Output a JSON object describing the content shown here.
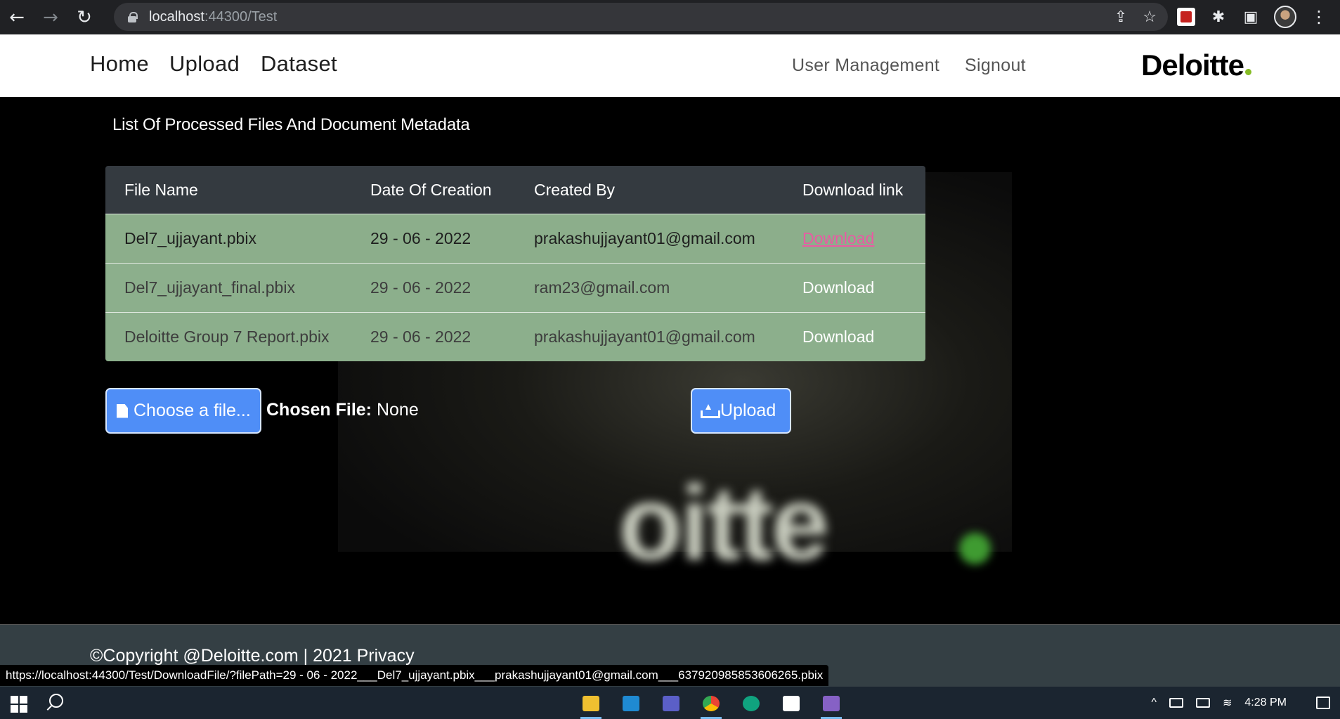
{
  "browser": {
    "url_host": "localhost",
    "url_path": ":44300/Test"
  },
  "navbar": {
    "links": [
      "Home",
      "Upload",
      "Dataset"
    ],
    "user_management": "User Management",
    "signout": "Signout",
    "logo": "Deloitte"
  },
  "main": {
    "heading": "List Of Processed Files And Document Metadata",
    "table": {
      "headers": [
        "File Name",
        "Date Of Creation",
        "Created By",
        "Download link"
      ],
      "rows": [
        {
          "file": "Del7_ujjayant.pbix",
          "date": "29 - 06 - 2022",
          "by": "prakashujjayant01@gmail.com",
          "link": "Download"
        },
        {
          "file": "Del7_ujjayant_final.pbix",
          "date": "29 - 06 - 2022",
          "by": "ram23@gmail.com",
          "link": "Download"
        },
        {
          "file": "Deloitte Group 7 Report.pbix",
          "date": "29 - 06 - 2022",
          "by": "prakashujjayant01@gmail.com",
          "link": "Download"
        }
      ]
    },
    "choose_file": "Choose a file...",
    "chosen_label": "Chosen File:",
    "chosen_value": "None",
    "upload": "Upload",
    "bg_word": "oitte"
  },
  "footer": {
    "text": "©Copyright @Deloitte.com | 2021 Privacy"
  },
  "status_bar_url": "https://localhost:44300/Test/DownloadFile/?filePath=29 - 06 - 2022___Del7_ujjayant.pbix___prakashujjayant01@gmail.com___637920985853606265.pbix",
  "taskbar": {
    "time": "4:28 PM",
    "apps": [
      "file-explorer-icon",
      "vscode-icon",
      "teams-icon",
      "chrome-icon",
      "chatgpt-icon",
      "box-icon",
      "visual-studio-icon"
    ]
  }
}
